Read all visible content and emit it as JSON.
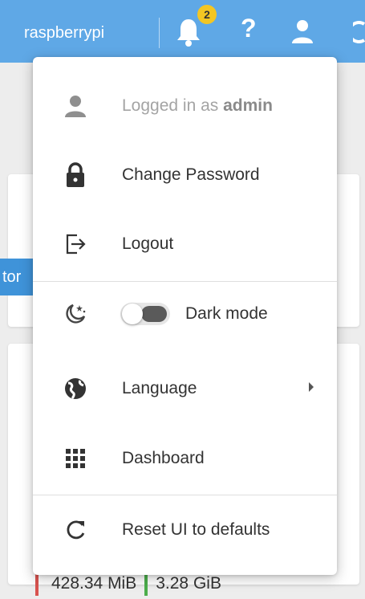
{
  "topbar": {
    "hostname": "raspberrypi",
    "notification_count": "2",
    "background_color": "#5fa8e6",
    "icons": [
      "bell-icon",
      "help-icon",
      "user-icon",
      "power-icon"
    ]
  },
  "background": {
    "button_partial_label": "tor",
    "memory_used": "428.34 MiB",
    "memory_total": "3.28 GiB"
  },
  "menu": {
    "logged_in_prefix": "Logged in as ",
    "logged_in_user": "admin",
    "change_password": "Change Password",
    "logout": "Logout",
    "dark_mode": "Dark mode",
    "dark_mode_enabled": false,
    "language": "Language",
    "dashboard": "Dashboard",
    "reset_ui": "Reset UI to defaults",
    "item_icons": [
      "user-icon",
      "lock-icon",
      "logout-icon",
      "moon-icon",
      "globe-icon",
      "grid-icon",
      "refresh-icon"
    ]
  }
}
